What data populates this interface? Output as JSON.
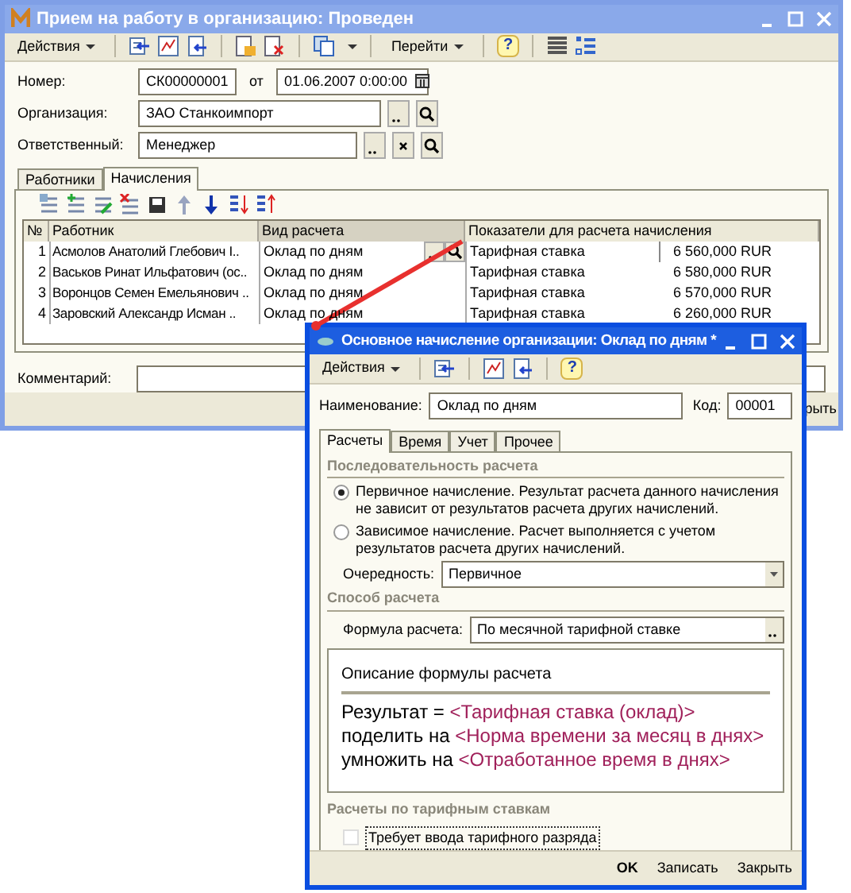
{
  "main_window": {
    "title": "Прием на работу в организацию: Проведен",
    "toolbar": {
      "actions_menu": "Действия",
      "goto_menu": "Перейти",
      "help": "?"
    },
    "number": {
      "label": "Номер:",
      "value": "СК00000001"
    },
    "date": {
      "separator": "от",
      "value": "01.06.2007 0:00:00"
    },
    "organization": {
      "label": "Организация:",
      "value": "ЗАО Станкоимпорт"
    },
    "responsible": {
      "label": "Ответственный:",
      "value": "Менеджер"
    },
    "tabs": [
      {
        "label": "Работники",
        "selected": false
      },
      {
        "label": "Начисления",
        "selected": true
      }
    ],
    "table": {
      "columns": [
        "№",
        "Работник",
        "Вид расчета",
        "Показатели для расчета начисления"
      ],
      "rows": [
        {
          "number": "1",
          "employee": "Асмолов Анатолий Глебович I..",
          "calc_type": "Оклад по дням",
          "indicator": "Тарифная ставка",
          "amount": "6 560,000 RUR",
          "editing": true
        },
        {
          "number": "2",
          "employee": "Васьков Ринат Ильфатович (ос..",
          "calc_type": "Оклад по дням",
          "indicator": "Тарифная ставка",
          "amount": "6 580,000 RUR",
          "editing": false
        },
        {
          "number": "3",
          "employee": "Воронцов Семен Емельянович ..",
          "calc_type": "Оклад по дням",
          "indicator": "Тарифная ставка",
          "amount": "6 570,000 RUR",
          "editing": false
        },
        {
          "number": "4",
          "employee": "Заровский Александр Исман ..",
          "calc_type": "Оклад по дням",
          "indicator": "Тарифная ставка",
          "amount": "6 260,000 RUR",
          "editing": false
        }
      ]
    },
    "comment": {
      "label": "Комментарий:"
    },
    "close_button": "рыть"
  },
  "dialog": {
    "title": "Основное начисление организации: Оклад по дням *",
    "toolbar": {
      "actions_menu": "Действия",
      "help": "?"
    },
    "name": {
      "label": "Наименование:",
      "value": "Оклад по дням"
    },
    "code": {
      "label": "Код:",
      "value": "00001"
    },
    "tabs": [
      {
        "label": "Расчеты",
        "selected": true
      },
      {
        "label": "Время",
        "selected": false
      },
      {
        "label": "Учет",
        "selected": false
      },
      {
        "label": "Прочее",
        "selected": false
      }
    ],
    "sequence_section": "Последовательность расчета",
    "radios": [
      {
        "label": "Первичное начисление. Результат расчета данного начисления не зависит от результатов расчета других начислений.",
        "selected": true
      },
      {
        "label": "Зависимое начисление. Расчет выполняется с учетом результатов расчета других начислений.",
        "selected": false
      }
    ],
    "order": {
      "label": "Очередность:",
      "value": "Первичное"
    },
    "method_section": "Способ расчета",
    "formula": {
      "label": "Формула расчета:",
      "value": "По месячной тарифной ставке"
    },
    "description": {
      "title": "Описание формулы расчета",
      "segments": [
        {
          "kind": "plain",
          "text": "Результат = "
        },
        {
          "kind": "param",
          "text": "<Тарифная ставка (оклад)>"
        },
        {
          "kind": "plain",
          "text": " поделить на "
        },
        {
          "kind": "param",
          "text": "<Норма времени за месяц в днях>"
        },
        {
          "kind": "plain",
          "text": " умножить на "
        },
        {
          "kind": "param",
          "text": "<Отработанное время в днях>"
        }
      ]
    },
    "rates_section": "Расчеты по тарифным ставкам",
    "rate_checkbox": {
      "label": "Требует ввода тарифного разряда",
      "checked": false
    },
    "buttons": [
      "OK",
      "Записать",
      "Закрыть"
    ]
  }
}
